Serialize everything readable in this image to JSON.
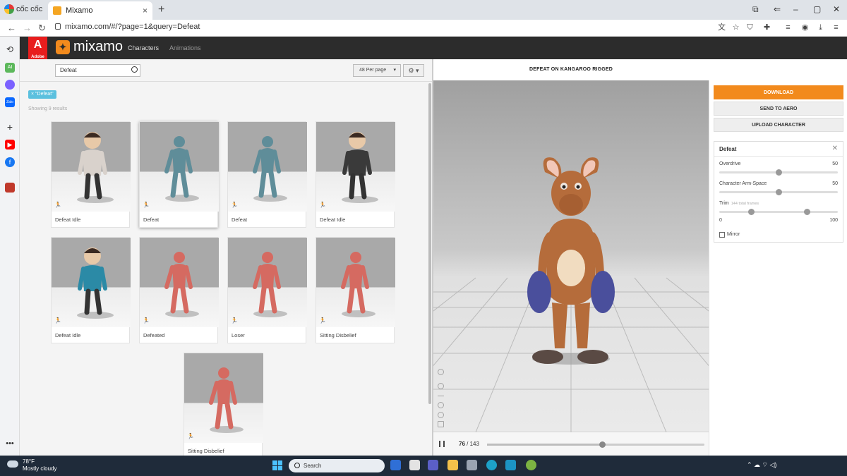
{
  "browser": {
    "brand": "cốc cốc",
    "tab_title": "Mixamo",
    "tab_close": "×",
    "new_tab": "+",
    "url": "mixamo.com/#/?page=1&query=Defeat",
    "nav": {
      "back": "←",
      "forward": "→",
      "reload": "↻"
    },
    "window_controls": {
      "minimize": "–",
      "maximize": "▢",
      "close": "✕"
    }
  },
  "sidebar": {
    "icons": [
      "history-icon",
      "ai-icon",
      "messenger-icon",
      "zalo-icon",
      "add-icon",
      "youtube-icon",
      "facebook-icon",
      "profile-icon",
      "more-icon"
    ],
    "ai_label": "AI",
    "zalo_label": "Zalo"
  },
  "header": {
    "adobe_logo": "A",
    "adobe_word": "Adobe",
    "app_name": "mixamo",
    "nav": [
      {
        "label": "Characters",
        "active": true
      },
      {
        "label": "Animations",
        "active": false
      }
    ]
  },
  "search": {
    "value": "Defeat",
    "per_page": "48 Per page",
    "settings_label": "⚙ ▾"
  },
  "filter_tag": "× \"Defeat\"",
  "results_text": "Showing 9 results",
  "animations": [
    {
      "label": "Defeat Idle",
      "type": "cartoon",
      "color": "#d9d2cc"
    },
    {
      "label": "Defeat",
      "type": "robot",
      "color": "#5f8d99",
      "selected": true
    },
    {
      "label": "Defeat",
      "type": "robot",
      "color": "#5f8d99"
    },
    {
      "label": "Defeat Idle",
      "type": "cartoon",
      "color": "#3a3a3a"
    },
    {
      "label": "Defeat Idle",
      "type": "cartoon",
      "color": "#2b8aa6"
    },
    {
      "label": "Defeated",
      "type": "robot",
      "color": "#d56a61"
    },
    {
      "label": "Loser",
      "type": "robot",
      "color": "#d56a61"
    },
    {
      "label": "Sitting Disbelief",
      "type": "robot",
      "color": "#d56a61"
    },
    {
      "label": "Sitting Disbelief",
      "type": "robot",
      "color": "#d56a61"
    }
  ],
  "viewer": {
    "title": "DEFEAT ON KANGAROO RIGGED",
    "frame_current": "76",
    "frame_total": "/ 143",
    "progress": 0.53
  },
  "actions": {
    "download": "DOWNLOAD",
    "send_to_aero": "SEND TO AERO",
    "upload_character": "UPLOAD CHARACTER"
  },
  "params": {
    "title": "Defeat",
    "close": "✕",
    "overdrive": {
      "label": "Overdrive",
      "value": "50",
      "level": 0.5
    },
    "arm_space": {
      "label": "Character Arm-Space",
      "value": "50",
      "level": 0.5
    },
    "trim": {
      "label": "Trim",
      "sub": "144 total frames",
      "min": "0",
      "max": "100",
      "start": 0.27,
      "end": 0.74
    },
    "mirror": "Mirror"
  },
  "taskbar": {
    "temp": "78°F",
    "weather": "Mostly cloudy",
    "search": "Search"
  },
  "colors": {
    "accent": "#f28a1d",
    "header_bg": "#2c2c2c",
    "tag": "#5bc0de",
    "kangaroo": "#b56c3b",
    "gloves": "#4a4f9c"
  }
}
